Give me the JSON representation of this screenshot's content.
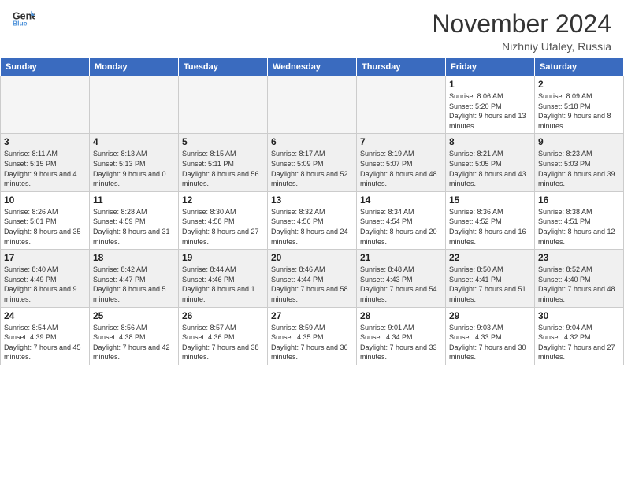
{
  "header": {
    "logo_line1": "General",
    "logo_line2": "Blue",
    "month": "November 2024",
    "location": "Nizhniy Ufaley, Russia"
  },
  "days_of_week": [
    "Sunday",
    "Monday",
    "Tuesday",
    "Wednesday",
    "Thursday",
    "Friday",
    "Saturday"
  ],
  "weeks": [
    [
      {
        "num": "",
        "info": "",
        "empty": true
      },
      {
        "num": "",
        "info": "",
        "empty": true
      },
      {
        "num": "",
        "info": "",
        "empty": true
      },
      {
        "num": "",
        "info": "",
        "empty": true
      },
      {
        "num": "",
        "info": "",
        "empty": true
      },
      {
        "num": "1",
        "info": "Sunrise: 8:06 AM\nSunset: 5:20 PM\nDaylight: 9 hours and 13 minutes."
      },
      {
        "num": "2",
        "info": "Sunrise: 8:09 AM\nSunset: 5:18 PM\nDaylight: 9 hours and 8 minutes."
      }
    ],
    [
      {
        "num": "3",
        "info": "Sunrise: 8:11 AM\nSunset: 5:15 PM\nDaylight: 9 hours and 4 minutes."
      },
      {
        "num": "4",
        "info": "Sunrise: 8:13 AM\nSunset: 5:13 PM\nDaylight: 9 hours and 0 minutes."
      },
      {
        "num": "5",
        "info": "Sunrise: 8:15 AM\nSunset: 5:11 PM\nDaylight: 8 hours and 56 minutes."
      },
      {
        "num": "6",
        "info": "Sunrise: 8:17 AM\nSunset: 5:09 PM\nDaylight: 8 hours and 52 minutes."
      },
      {
        "num": "7",
        "info": "Sunrise: 8:19 AM\nSunset: 5:07 PM\nDaylight: 8 hours and 48 minutes."
      },
      {
        "num": "8",
        "info": "Sunrise: 8:21 AM\nSunset: 5:05 PM\nDaylight: 8 hours and 43 minutes."
      },
      {
        "num": "9",
        "info": "Sunrise: 8:23 AM\nSunset: 5:03 PM\nDaylight: 8 hours and 39 minutes."
      }
    ],
    [
      {
        "num": "10",
        "info": "Sunrise: 8:26 AM\nSunset: 5:01 PM\nDaylight: 8 hours and 35 minutes."
      },
      {
        "num": "11",
        "info": "Sunrise: 8:28 AM\nSunset: 4:59 PM\nDaylight: 8 hours and 31 minutes."
      },
      {
        "num": "12",
        "info": "Sunrise: 8:30 AM\nSunset: 4:58 PM\nDaylight: 8 hours and 27 minutes."
      },
      {
        "num": "13",
        "info": "Sunrise: 8:32 AM\nSunset: 4:56 PM\nDaylight: 8 hours and 24 minutes."
      },
      {
        "num": "14",
        "info": "Sunrise: 8:34 AM\nSunset: 4:54 PM\nDaylight: 8 hours and 20 minutes."
      },
      {
        "num": "15",
        "info": "Sunrise: 8:36 AM\nSunset: 4:52 PM\nDaylight: 8 hours and 16 minutes."
      },
      {
        "num": "16",
        "info": "Sunrise: 8:38 AM\nSunset: 4:51 PM\nDaylight: 8 hours and 12 minutes."
      }
    ],
    [
      {
        "num": "17",
        "info": "Sunrise: 8:40 AM\nSunset: 4:49 PM\nDaylight: 8 hours and 9 minutes."
      },
      {
        "num": "18",
        "info": "Sunrise: 8:42 AM\nSunset: 4:47 PM\nDaylight: 8 hours and 5 minutes."
      },
      {
        "num": "19",
        "info": "Sunrise: 8:44 AM\nSunset: 4:46 PM\nDaylight: 8 hours and 1 minute."
      },
      {
        "num": "20",
        "info": "Sunrise: 8:46 AM\nSunset: 4:44 PM\nDaylight: 7 hours and 58 minutes."
      },
      {
        "num": "21",
        "info": "Sunrise: 8:48 AM\nSunset: 4:43 PM\nDaylight: 7 hours and 54 minutes."
      },
      {
        "num": "22",
        "info": "Sunrise: 8:50 AM\nSunset: 4:41 PM\nDaylight: 7 hours and 51 minutes."
      },
      {
        "num": "23",
        "info": "Sunrise: 8:52 AM\nSunset: 4:40 PM\nDaylight: 7 hours and 48 minutes."
      }
    ],
    [
      {
        "num": "24",
        "info": "Sunrise: 8:54 AM\nSunset: 4:39 PM\nDaylight: 7 hours and 45 minutes."
      },
      {
        "num": "25",
        "info": "Sunrise: 8:56 AM\nSunset: 4:38 PM\nDaylight: 7 hours and 42 minutes."
      },
      {
        "num": "26",
        "info": "Sunrise: 8:57 AM\nSunset: 4:36 PM\nDaylight: 7 hours and 38 minutes."
      },
      {
        "num": "27",
        "info": "Sunrise: 8:59 AM\nSunset: 4:35 PM\nDaylight: 7 hours and 36 minutes."
      },
      {
        "num": "28",
        "info": "Sunrise: 9:01 AM\nSunset: 4:34 PM\nDaylight: 7 hours and 33 minutes."
      },
      {
        "num": "29",
        "info": "Sunrise: 9:03 AM\nSunset: 4:33 PM\nDaylight: 7 hours and 30 minutes."
      },
      {
        "num": "30",
        "info": "Sunrise: 9:04 AM\nSunset: 4:32 PM\nDaylight: 7 hours and 27 minutes."
      }
    ]
  ]
}
